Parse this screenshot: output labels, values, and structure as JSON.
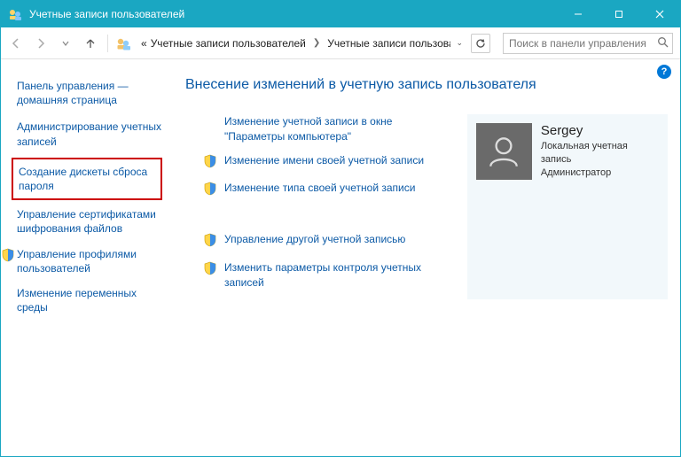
{
  "window": {
    "title": "Учетные записи пользователей"
  },
  "breadcrumb": {
    "lead": "«",
    "part1": "Учетные записи пользователей",
    "part2": "Учетные записи пользователей"
  },
  "search": {
    "placeholder": "Поиск в панели управления"
  },
  "sidebar": {
    "home": "Панель управления — домашняя страница",
    "items": [
      {
        "label": "Администрирование учетных записей",
        "shield": false,
        "hl": false
      },
      {
        "label": "Создание дискеты сброса пароля",
        "shield": false,
        "hl": true
      },
      {
        "label": "Управление сертификатами шифрования файлов",
        "shield": false,
        "hl": false
      },
      {
        "label": "Управление профилями пользователей",
        "shield": true,
        "hl": false
      },
      {
        "label": "Изменение переменных среды",
        "shield": false,
        "hl": false
      }
    ]
  },
  "main": {
    "heading": "Внесение изменений в учетную запись пользователя",
    "tasks_a": [
      {
        "label": "Изменение учетной записи в окне \"Параметры компьютера\"",
        "shield": false
      },
      {
        "label": "Изменение имени своей учетной записи",
        "shield": true
      },
      {
        "label": "Изменение типа своей учетной записи",
        "shield": true
      }
    ],
    "tasks_b": [
      {
        "label": "Управление другой учетной записью",
        "shield": true
      },
      {
        "label": "Изменить параметры контроля учетных записей",
        "shield": true
      }
    ]
  },
  "user": {
    "name": "Sergey",
    "line1": "Локальная учетная запись",
    "line2": "Администратор"
  }
}
